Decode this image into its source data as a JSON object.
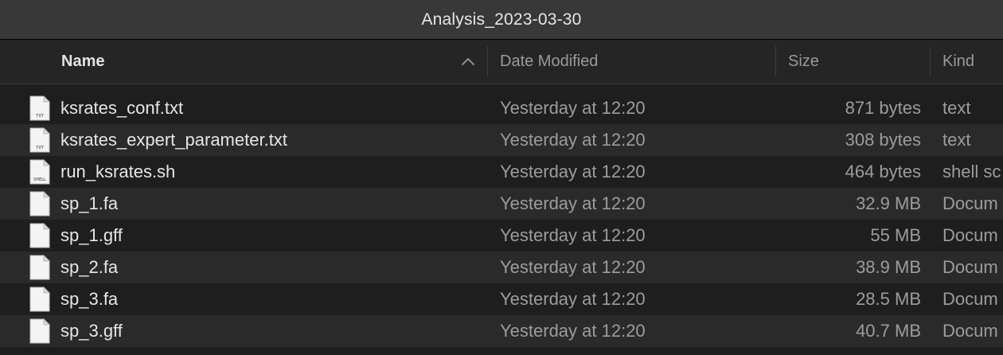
{
  "window": {
    "title": "Analysis_2023-03-30"
  },
  "columns": {
    "name": "Name",
    "date_modified": "Date Modified",
    "size": "Size",
    "kind": "Kind",
    "sort_indicator": "chevron-up-icon"
  },
  "files": [
    {
      "name": "ksrates_conf.txt",
      "date": "Yesterday at 12:20",
      "size": "871 bytes",
      "kind": "text",
      "icon": "txt-file-icon",
      "icon_label": "TXT"
    },
    {
      "name": "ksrates_expert_parameter.txt",
      "date": "Yesterday at 12:20",
      "size": "308 bytes",
      "kind": "text",
      "icon": "txt-file-icon",
      "icon_label": "TXT"
    },
    {
      "name": "run_ksrates.sh",
      "date": "Yesterday at 12:20",
      "size": "464 bytes",
      "kind": "shell sc",
      "icon": "shell-file-icon",
      "icon_label": "SHELL"
    },
    {
      "name": "sp_1.fa",
      "date": "Yesterday at 12:20",
      "size": "32.9 MB",
      "kind": "Docum",
      "icon": "document-icon",
      "icon_label": ""
    },
    {
      "name": "sp_1.gff",
      "date": "Yesterday at 12:20",
      "size": "55 MB",
      "kind": "Docum",
      "icon": "document-icon",
      "icon_label": ""
    },
    {
      "name": "sp_2.fa",
      "date": "Yesterday at 12:20",
      "size": "38.9 MB",
      "kind": "Docum",
      "icon": "document-icon",
      "icon_label": ""
    },
    {
      "name": "sp_3.fa",
      "date": "Yesterday at 12:20",
      "size": "28.5 MB",
      "kind": "Docum",
      "icon": "document-icon",
      "icon_label": ""
    },
    {
      "name": "sp_3.gff",
      "date": "Yesterday at 12:20",
      "size": "40.7 MB",
      "kind": "Docum",
      "icon": "document-icon",
      "icon_label": ""
    }
  ],
  "colors": {
    "background": "#1e1e1e",
    "alt_row": "#2a2a2a",
    "titlebar": "#383838",
    "header": "#252525",
    "primary_text": "#e6e6e6",
    "secondary_text": "#9c9c9c"
  }
}
